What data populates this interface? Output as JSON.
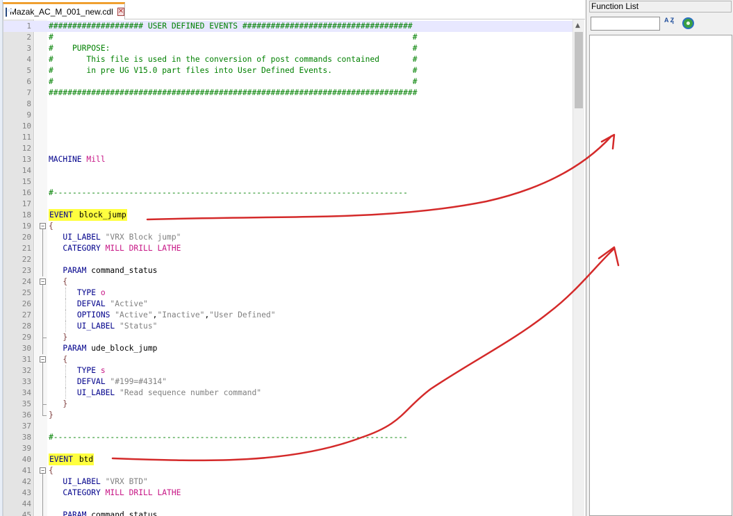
{
  "tab": {
    "title": "Mazak_AC_M_001_new.cdl",
    "close_glyph": "✕"
  },
  "function_list": {
    "title": "Function List",
    "search_value": "",
    "sort_label": "A Z"
  },
  "editor": {
    "lines": [
      {
        "n": "1",
        "segs": [
          {
            "c": "c-comment",
            "t": "#################### USER DEFINED EVENTS ####################################"
          }
        ]
      },
      {
        "n": "2",
        "segs": [
          {
            "c": "c-comment",
            "t": "#                                                                            #"
          }
        ]
      },
      {
        "n": "3",
        "segs": [
          {
            "c": "c-comment",
            "t": "#    PURPOSE:                                                                #"
          }
        ]
      },
      {
        "n": "4",
        "segs": [
          {
            "c": "c-comment",
            "t": "#       This file is used in the conversion of post commands contained       #"
          }
        ]
      },
      {
        "n": "5",
        "segs": [
          {
            "c": "c-comment",
            "t": "#       in pre UG V15.0 part files into User Defined Events.                 #"
          }
        ]
      },
      {
        "n": "6",
        "segs": [
          {
            "c": "c-comment",
            "t": "#                                                                            #"
          }
        ]
      },
      {
        "n": "7",
        "segs": [
          {
            "c": "c-comment",
            "t": "##############################################################################"
          }
        ]
      },
      {
        "n": "8",
        "segs": []
      },
      {
        "n": "9",
        "segs": []
      },
      {
        "n": "10",
        "segs": []
      },
      {
        "n": "11",
        "segs": []
      },
      {
        "n": "12",
        "segs": []
      },
      {
        "n": "13",
        "segs": [
          {
            "c": "c-kw",
            "t": "MACHINE "
          },
          {
            "c": "c-type",
            "t": "Mill"
          }
        ]
      },
      {
        "n": "14",
        "segs": []
      },
      {
        "n": "15",
        "segs": []
      },
      {
        "n": "16",
        "segs": [
          {
            "c": "c-comment",
            "t": "#---------------------------------------------------------------------------"
          }
        ]
      },
      {
        "n": "17",
        "segs": []
      },
      {
        "n": "18",
        "segs": [
          {
            "c": "c-kw hl",
            "t": "EVENT "
          },
          {
            "c": "hl",
            "t": "block_jump"
          }
        ]
      },
      {
        "n": "19",
        "segs": [
          {
            "c": "c-brace",
            "t": "{"
          }
        ]
      },
      {
        "n": "20",
        "segs": [
          {
            "c": "",
            "t": "   "
          },
          {
            "c": "c-kw",
            "t": "UI_LABEL "
          },
          {
            "c": "c-str",
            "t": "\"VRX Block jump\""
          }
        ]
      },
      {
        "n": "21",
        "segs": [
          {
            "c": "",
            "t": "   "
          },
          {
            "c": "c-kw",
            "t": "CATEGORY "
          },
          {
            "c": "c-type",
            "t": "MILL DRILL LATHE"
          }
        ]
      },
      {
        "n": "22",
        "segs": []
      },
      {
        "n": "23",
        "segs": [
          {
            "c": "",
            "t": "   "
          },
          {
            "c": "c-kw",
            "t": "PARAM "
          },
          {
            "c": "",
            "t": "command_status"
          }
        ]
      },
      {
        "n": "24",
        "segs": [
          {
            "c": "",
            "t": "   "
          },
          {
            "c": "c-brace",
            "t": "{"
          }
        ]
      },
      {
        "n": "25",
        "segs": [
          {
            "c": "",
            "t": "      "
          },
          {
            "c": "c-kw",
            "t": "TYPE "
          },
          {
            "c": "c-type",
            "t": "o"
          }
        ]
      },
      {
        "n": "26",
        "segs": [
          {
            "c": "",
            "t": "      "
          },
          {
            "c": "c-kw",
            "t": "DEFVAL "
          },
          {
            "c": "c-str",
            "t": "\"Active\""
          }
        ]
      },
      {
        "n": "27",
        "segs": [
          {
            "c": "",
            "t": "      "
          },
          {
            "c": "c-kw",
            "t": "OPTIONS "
          },
          {
            "c": "c-str",
            "t": "\"Active\""
          },
          {
            "c": "",
            "t": ","
          },
          {
            "c": "c-str",
            "t": "\"Inactive\""
          },
          {
            "c": "",
            "t": ","
          },
          {
            "c": "c-str",
            "t": "\"User Defined\""
          }
        ]
      },
      {
        "n": "28",
        "segs": [
          {
            "c": "",
            "t": "      "
          },
          {
            "c": "c-kw",
            "t": "UI_LABEL "
          },
          {
            "c": "c-str",
            "t": "\"Status\""
          }
        ]
      },
      {
        "n": "29",
        "segs": [
          {
            "c": "",
            "t": "   "
          },
          {
            "c": "c-brace",
            "t": "}"
          }
        ]
      },
      {
        "n": "30",
        "segs": [
          {
            "c": "",
            "t": "   "
          },
          {
            "c": "c-kw",
            "t": "PARAM "
          },
          {
            "c": "",
            "t": "ude_block_jump"
          }
        ]
      },
      {
        "n": "31",
        "segs": [
          {
            "c": "",
            "t": "   "
          },
          {
            "c": "c-brace",
            "t": "{"
          }
        ]
      },
      {
        "n": "32",
        "segs": [
          {
            "c": "",
            "t": "      "
          },
          {
            "c": "c-kw",
            "t": "TYPE "
          },
          {
            "c": "c-type",
            "t": "s"
          }
        ]
      },
      {
        "n": "33",
        "segs": [
          {
            "c": "",
            "t": "      "
          },
          {
            "c": "c-kw",
            "t": "DEFVAL "
          },
          {
            "c": "c-str",
            "t": "\"#199=#4314\""
          }
        ]
      },
      {
        "n": "34",
        "segs": [
          {
            "c": "",
            "t": "      "
          },
          {
            "c": "c-kw",
            "t": "UI_LABEL "
          },
          {
            "c": "c-str",
            "t": "\"Read sequence number command\""
          }
        ]
      },
      {
        "n": "35",
        "segs": [
          {
            "c": "",
            "t": "   "
          },
          {
            "c": "c-brace",
            "t": "}"
          }
        ]
      },
      {
        "n": "36",
        "segs": [
          {
            "c": "c-brace",
            "t": "}"
          }
        ]
      },
      {
        "n": "37",
        "segs": []
      },
      {
        "n": "38",
        "segs": [
          {
            "c": "c-comment",
            "t": "#---------------------------------------------------------------------------"
          }
        ]
      },
      {
        "n": "39",
        "segs": []
      },
      {
        "n": "40",
        "segs": [
          {
            "c": "c-kw hl",
            "t": "EVENT "
          },
          {
            "c": "hl",
            "t": "btd"
          }
        ]
      },
      {
        "n": "41",
        "segs": [
          {
            "c": "c-brace",
            "t": "{"
          }
        ]
      },
      {
        "n": "42",
        "segs": [
          {
            "c": "",
            "t": "   "
          },
          {
            "c": "c-kw",
            "t": "UI_LABEL "
          },
          {
            "c": "c-str",
            "t": "\"VRX BTD\""
          }
        ]
      },
      {
        "n": "43",
        "segs": [
          {
            "c": "",
            "t": "   "
          },
          {
            "c": "c-kw",
            "t": "CATEGORY "
          },
          {
            "c": "c-type",
            "t": "MILL DRILL LATHE"
          }
        ]
      },
      {
        "n": "44",
        "segs": []
      },
      {
        "n": "45",
        "segs": [
          {
            "c": "",
            "t": "   "
          },
          {
            "c": "c-kw",
            "t": "PARAM "
          },
          {
            "c": "",
            "t": "command_status"
          }
        ]
      }
    ],
    "fold_open": [
      "19",
      "24",
      "31",
      "41"
    ],
    "fold_mid": [
      "20",
      "21",
      "22",
      "23",
      "25",
      "26",
      "27",
      "28",
      "30",
      "32",
      "33",
      "34",
      "35",
      "42",
      "43",
      "44",
      "45"
    ],
    "fold_close_inner": [
      "29",
      "35"
    ],
    "fold_close_outer": [
      "36"
    ]
  },
  "colors": {
    "annotation": "#d42a2a",
    "highlight": "#ffff3f",
    "current_line": "#e8e8ff"
  }
}
